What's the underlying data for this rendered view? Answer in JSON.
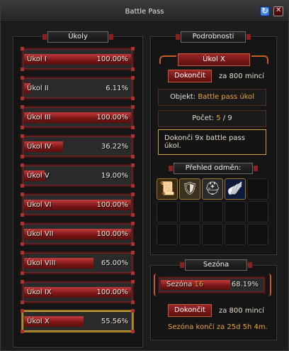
{
  "window": {
    "title": "Battle Pass"
  },
  "tasks_panel": {
    "title": "Úkoly"
  },
  "tasks": [
    {
      "name": "Úkol I",
      "percent_text": "100.00%",
      "progress": 1.0
    },
    {
      "name": "Úkol II",
      "percent_text": "6.11%",
      "progress": 0.0611
    },
    {
      "name": "Úkol III",
      "percent_text": "100.00%",
      "progress": 1.0
    },
    {
      "name": "Úkol IV",
      "percent_text": "36.22%",
      "progress": 0.3622
    },
    {
      "name": "Úkol V",
      "percent_text": "19.00%",
      "progress": 0.19
    },
    {
      "name": "Úkol VI",
      "percent_text": "100.00%",
      "progress": 1.0
    },
    {
      "name": "Úkol VII",
      "percent_text": "100.00%",
      "progress": 1.0
    },
    {
      "name": "Úkol VIII",
      "percent_text": "65.00%",
      "progress": 0.65
    },
    {
      "name": "Úkol IX",
      "percent_text": "100.00%",
      "progress": 1.0
    },
    {
      "name": "Úkol X",
      "percent_text": "55.56%",
      "progress": 0.5556
    }
  ],
  "selected_task_index": 9,
  "details": {
    "title": "Podrobnosti",
    "task_name": "Úkol X",
    "finish_label": "Dokončit",
    "finish_cost": "za 800 mincí",
    "object_label": "Objekt:",
    "object_value": "Battle pass úkol",
    "count_label": "Počet:",
    "count_current": "5",
    "count_sep": " / ",
    "count_total": "9",
    "description": "Dokonči 9x battle pass úkol.",
    "rewards_title": "Přehled odměn:",
    "rewards": [
      {
        "icon": "scroll-lightning-icon",
        "glyph": "📜"
      },
      {
        "icon": "knight-armor-icon",
        "glyph": "🛡"
      },
      {
        "icon": "helmet-icon",
        "glyph": "⛑"
      },
      {
        "icon": "blue-wings-icon",
        "glyph": "🪽"
      }
    ]
  },
  "season": {
    "title": "Sezóna",
    "label": "Sezóna",
    "number": "16",
    "percent_text": "68.19%",
    "progress": 0.6819,
    "finish_label": "Dokončit",
    "finish_cost": "za 800 mincí",
    "ends_text": "Sezóna končí za 25d 5h 4m."
  },
  "colors": {
    "accent_gold": "#e9a53a",
    "bar_red": "#9a2020",
    "frame_dark_red": "#4a1414"
  }
}
